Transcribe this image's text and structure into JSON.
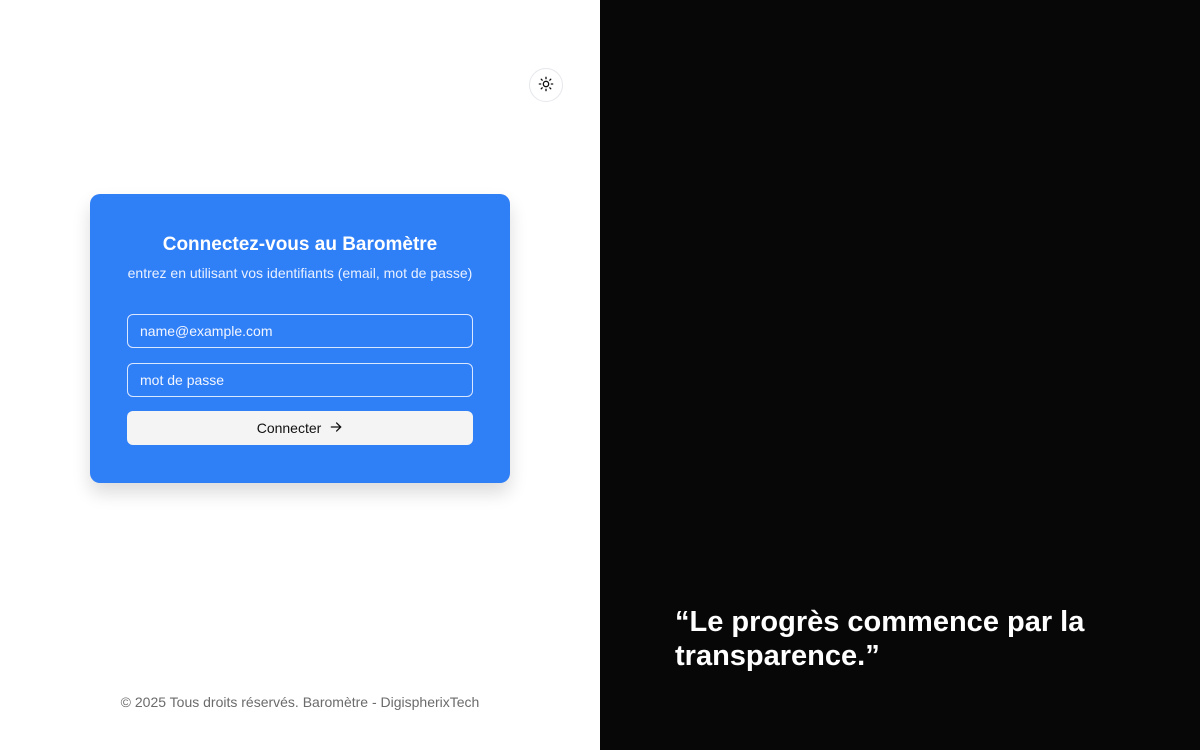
{
  "theme_toggle": {
    "icon": "sun-icon"
  },
  "login": {
    "title": "Connectez-vous au Baromètre",
    "subtitle": "entrez en utilisant vos identifiants (email, mot de passe)",
    "email_placeholder": "name@example.com",
    "email_value": "",
    "password_placeholder": "mot de passe",
    "password_value": "",
    "submit_label": "Connecter",
    "submit_icon": "arrow-right-icon"
  },
  "footer": {
    "text": "© 2025 Tous droits réservés. Baromètre - DigispherixTech"
  },
  "quote": {
    "text": "“Le progrès commence par la transparence.”"
  },
  "colors": {
    "card_background": "#2f7ff7",
    "right_panel_background": "#070707",
    "button_background": "#f4f4f5"
  }
}
